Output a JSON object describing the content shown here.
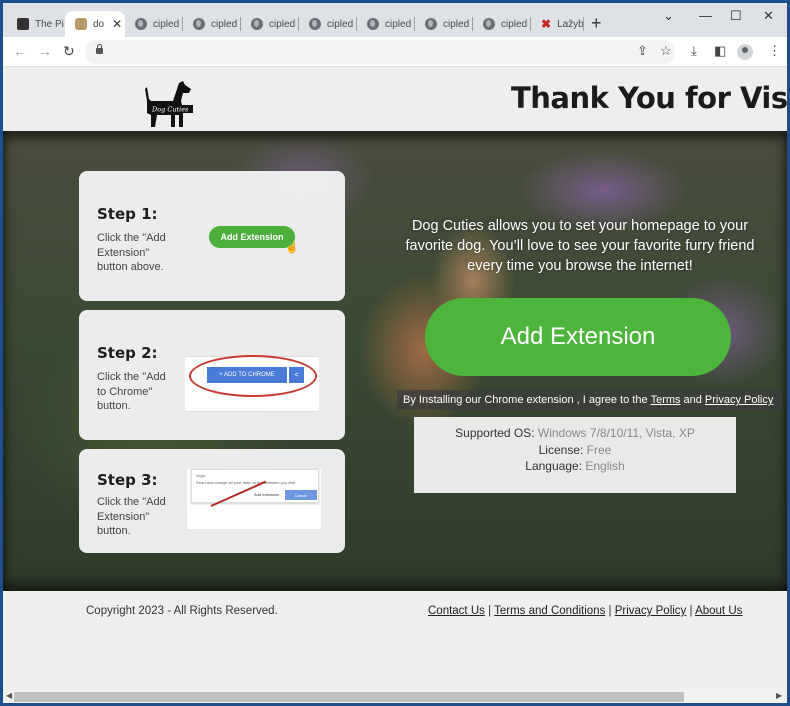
{
  "browser": {
    "tabs": [
      {
        "label": "The Pi",
        "icon": "printer-icon"
      },
      {
        "label": "do",
        "icon": "dog-favicon",
        "active": true
      },
      {
        "label": "cipled",
        "icon": "globe-icon"
      },
      {
        "label": "cipled",
        "icon": "globe-icon"
      },
      {
        "label": "cipled",
        "icon": "globe-icon"
      },
      {
        "label": "cipled",
        "icon": "globe-icon"
      },
      {
        "label": "cipled",
        "icon": "globe-icon"
      },
      {
        "label": "cipled",
        "icon": "globe-icon"
      },
      {
        "label": "cipled",
        "icon": "globe-icon"
      },
      {
        "label": "Lažyb",
        "icon": "red-figure-icon"
      }
    ],
    "close_tab": "✕",
    "new_tab": "+",
    "controls": {
      "tab_search": "⌄",
      "minimize": "—",
      "maximize": "☐",
      "close": "✕"
    },
    "nav": {
      "back": "←",
      "forward": "→",
      "reload": "↻"
    },
    "address": ""
  },
  "header": {
    "logo_text": "Dog Cuties",
    "title": "Thank You for Visit!"
  },
  "steps": [
    {
      "title": "Step 1:",
      "text": "Click the \"Add Extension\" button above.",
      "button": "Add Extension"
    },
    {
      "title": "Step 2:",
      "text": "Click the \"Add to Chrome\" button.",
      "button": "+ ADD TO CHROME"
    },
    {
      "title": "Step 3:",
      "text": "Click the \"Add Extension\" button.",
      "dialog_title": "Dogs",
      "dialog_text": "Read and change all your data on the websites you visit",
      "dialog_add": "Add extension",
      "dialog_cancel": "Cancel"
    }
  ],
  "main": {
    "description": "Dog Cuties allows you to set your homepage to your favorite dog. You’ll love to see your favorite furry friend every time you browse the internet!",
    "cta": "Add Extension",
    "agree_prefix": "By Installing our Chrome extension , I agree to the",
    "agree_terms": "Terms",
    "agree_and": "and",
    "agree_privacy": "Privacy Policy",
    "info": [
      {
        "key": "Supported OS:",
        "value": "Windows 7/8/10/11, Vista, XP"
      },
      {
        "key": "License:",
        "value": "Free"
      },
      {
        "key": "Language:",
        "value": "English"
      }
    ]
  },
  "footer": {
    "copyright": "Copyright 2023 - All Rights Reserved.",
    "links": [
      "Contact Us",
      "Terms and Conditions",
      "Privacy Policy",
      "About Us"
    ],
    "separator": "|"
  },
  "colors": {
    "accent_green": "#4db53c",
    "chrome_blue": "#4a7bd8"
  }
}
